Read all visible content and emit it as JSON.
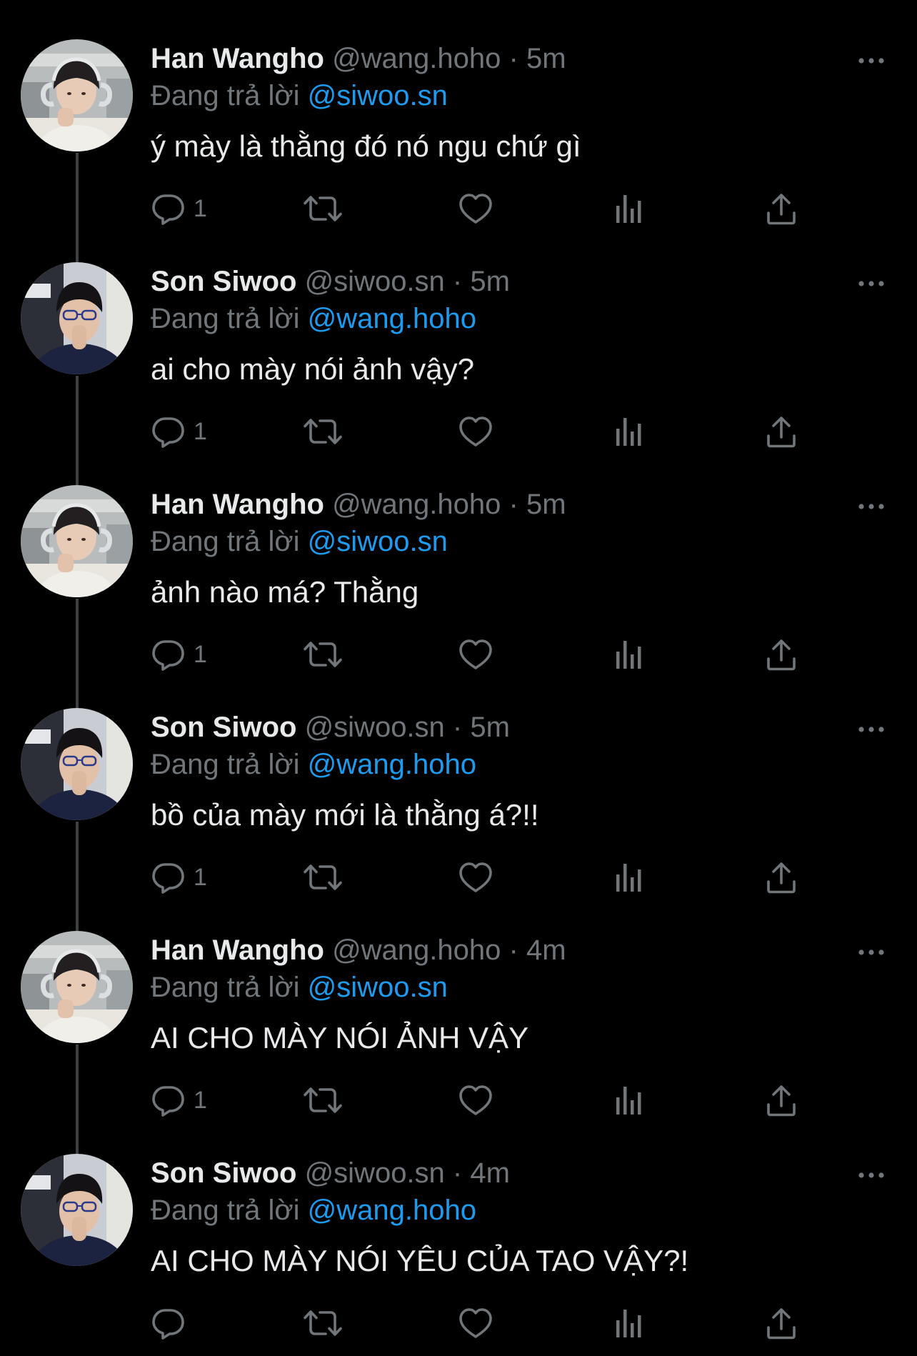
{
  "reply_prefix": "Đang trả lời",
  "tweets": [
    {
      "name": "Han Wangho",
      "handle": "@wang.hoho",
      "dot": "·",
      "time": "5m",
      "reply_to": "@siwoo.sn",
      "text": "ý mày là thằng đó nó ngu chứ gì",
      "reply_count": "1",
      "avatar": "han-wangho"
    },
    {
      "name": "Son Siwoo",
      "handle": "@siwoo.sn",
      "dot": "·",
      "time": "5m",
      "reply_to": "@wang.hoho",
      "text": "ai cho mày nói ảnh vậy?",
      "reply_count": "1",
      "avatar": "son-siwoo"
    },
    {
      "name": "Han Wangho",
      "handle": "@wang.hoho",
      "dot": "·",
      "time": "5m",
      "reply_to": "@siwoo.sn",
      "text": "ảnh nào má? Thằng",
      "reply_count": "1",
      "avatar": "han-wangho"
    },
    {
      "name": "Son Siwoo",
      "handle": "@siwoo.sn",
      "dot": "·",
      "time": "5m",
      "reply_to": "@wang.hoho",
      "text": "bồ của mày mới là thằng á?!!",
      "reply_count": "1",
      "avatar": "son-siwoo"
    },
    {
      "name": "Han Wangho",
      "handle": "@wang.hoho",
      "dot": "·",
      "time": "4m",
      "reply_to": "@siwoo.sn",
      "text": "AI CHO MÀY NÓI ẢNH VẬY",
      "reply_count": "1",
      "avatar": "han-wangho"
    },
    {
      "name": "Son Siwoo",
      "handle": "@siwoo.sn",
      "dot": "·",
      "time": "4m",
      "reply_to": "@wang.hoho",
      "text": "AI CHO MÀY NÓI YÊU CỦA TAO VẬY?!",
      "reply_count": "",
      "avatar": "son-siwoo"
    }
  ],
  "icons": {
    "reply": "reply-icon",
    "retweet": "retweet-icon",
    "like": "heart-icon",
    "views": "views-icon",
    "share": "share-icon",
    "more": "more-icon"
  },
  "colors": {
    "background": "#000000",
    "text": "#e7e9ea",
    "muted": "#71767b",
    "accent": "#1d9bf0",
    "thread_line": "#3e4144"
  }
}
